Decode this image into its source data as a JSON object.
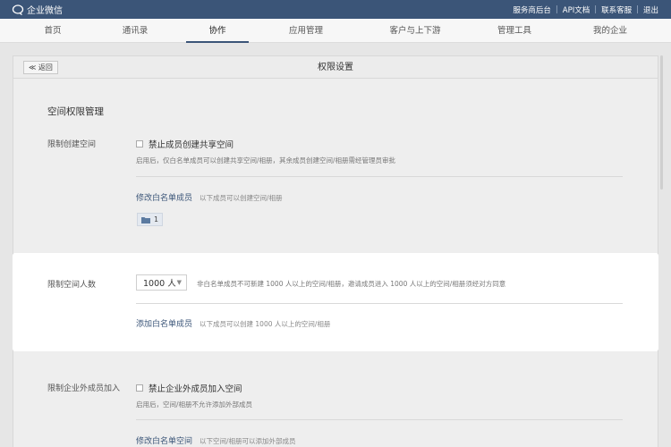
{
  "topbar": {
    "app_name": "企业微信",
    "links": [
      "服务商后台",
      "API文档",
      "联系客服",
      "退出"
    ]
  },
  "nav": {
    "items": [
      "首页",
      "通讯录",
      "协作",
      "应用管理",
      "客户与上下游",
      "管理工具",
      "我的企业"
    ],
    "active": "协作"
  },
  "panel": {
    "back_label": "≪ 返回",
    "title": "权限设置",
    "section_title": "空间权限管理"
  },
  "create_space": {
    "label": "限制创建空间",
    "checkbox_label": "禁止成员创建共享空间",
    "hint": "启用后，仅白名单成员可以创建共享空间/相册，其余成员创建空间/相册需经管理员审批",
    "link": "修改白名单成员",
    "link_hint": "以下成员可以创建空间/相册",
    "chip_count": "1"
  },
  "space_members": {
    "label": "限制空间人数",
    "select_value": "1000 人",
    "hint": "非白名单成员不可新建 1000 人以上的空间/相册，邀请成员进入 1000 人以上的空间/相册须经对方同意",
    "link": "添加白名单成员",
    "link_hint": "以下成员可以创建 1000 人以上的空间/相册"
  },
  "external_members": {
    "label": "限制企业外成员加入",
    "checkbox_label": "禁止企业外成员加入空间",
    "hint": "启用后，空间/相册不允许添加外部成员",
    "link": "修改白名单空间",
    "link_hint": "以下空间/相册可以添加外部成员"
  },
  "colors": {
    "brand": "#3b5578",
    "link": "#3b5578"
  }
}
